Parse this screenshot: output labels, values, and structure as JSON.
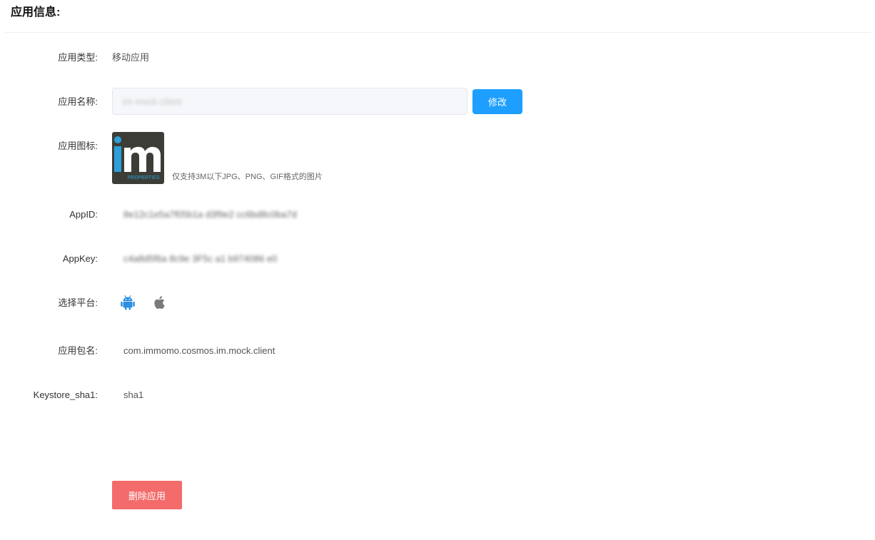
{
  "page": {
    "title": "应用信息:"
  },
  "form": {
    "type": {
      "label": "应用类型:",
      "value": "移动应用"
    },
    "name": {
      "label": "应用名称:",
      "value": "im mock client",
      "button_label": "修改"
    },
    "icon": {
      "label": "应用图标:",
      "hint": "仅支持3M以下JPG、PNG、GIF格式的图片",
      "logo_text": "PROPERTIES",
      "colors": {
        "background": "#3c3d37",
        "blue": "#2b9fd9",
        "white": "#ffffff"
      }
    },
    "appid": {
      "label": "AppID:",
      "value": "8e12c1e5a7f05b1a  d3f9e2 cc6bd8c0ba7d"
    },
    "appkey": {
      "label": "AppKey:",
      "value": "c4a8d5f6a 8c9e 3F5c a1 b974086 e0"
    },
    "platform": {
      "label": "选择平台:",
      "options": [
        {
          "icon": "android-icon",
          "color": "#2c8fe0",
          "selected": true
        },
        {
          "icon": "apple-icon",
          "color": "#7a7a7a",
          "selected": false
        }
      ]
    },
    "package": {
      "label": "应用包名:",
      "value": "com.immomo.cosmos.im.mock.client"
    },
    "sha1": {
      "label": "Keystore_sha1:",
      "value": "sha1"
    }
  },
  "actions": {
    "delete_label": "删除应用"
  },
  "colors": {
    "primary_button": "#1e9fff",
    "danger_button": "#f46b6b"
  }
}
